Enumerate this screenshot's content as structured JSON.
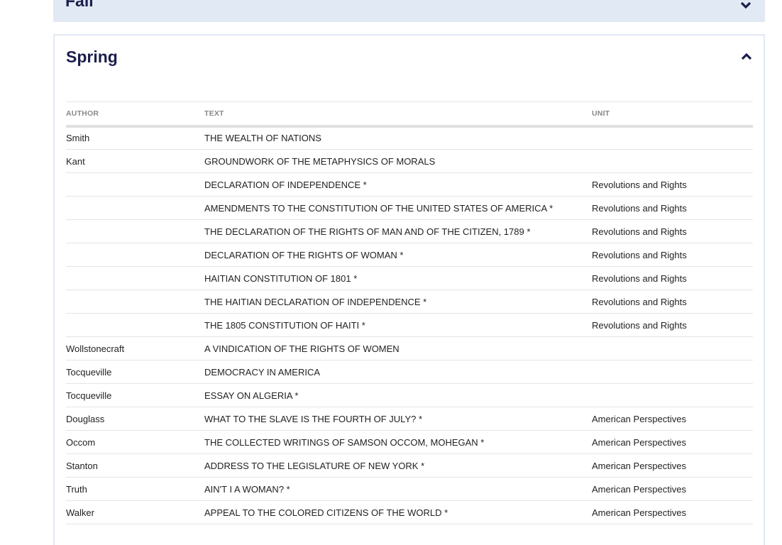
{
  "fall": {
    "title": "Fall"
  },
  "spring": {
    "title": "Spring",
    "headers": [
      "AUTHOR",
      "TEXT",
      "UNIT"
    ],
    "rows": [
      [
        "Smith",
        "THE WEALTH OF NATIONS",
        ""
      ],
      [
        "Kant",
        "GROUNDWORK OF THE METAPHYSICS OF MORALS",
        ""
      ],
      [
        "",
        "DECLARATION OF INDEPENDENCE *",
        "Revolutions and Rights"
      ],
      [
        "",
        "AMENDMENTS TO THE CONSTITUTION OF THE UNITED STATES OF AMERICA *",
        "Revolutions and Rights"
      ],
      [
        "",
        "THE DECLARATION OF THE RIGHTS OF MAN AND OF THE CITIZEN, 1789 *",
        "Revolutions and Rights"
      ],
      [
        "",
        "DECLARATION OF THE RIGHTS OF WOMAN *",
        "Revolutions and Rights"
      ],
      [
        "",
        "HAITIAN CONSTITUTION OF 1801 *",
        "Revolutions and Rights"
      ],
      [
        "",
        "THE HAITIAN DECLARATION OF INDEPENDENCE *",
        "Revolutions and Rights"
      ],
      [
        "",
        "THE 1805 CONSTITUTION OF HAITI *",
        "Revolutions and Rights"
      ],
      [
        "Wollstonecraft",
        "A VINDICATION OF THE RIGHTS OF WOMEN",
        ""
      ],
      [
        "Tocqueville",
        "DEMOCRACY IN AMERICA",
        ""
      ],
      [
        "Tocqueville",
        "ESSAY ON ALGERIA *",
        ""
      ],
      [
        "Douglass",
        "WHAT TO THE SLAVE IS THE FOURTH OF JULY? *",
        "American Perspectives"
      ],
      [
        "Occom",
        "THE COLLECTED WRITINGS OF SAMSON OCCOM, MOHEGAN *",
        "American Perspectives"
      ],
      [
        "Stanton",
        "ADDRESS TO THE LEGISLATURE OF NEW YORK *",
        "American Perspectives"
      ],
      [
        "Truth",
        "AIN'T I A WOMAN? *",
        "American Perspectives"
      ],
      [
        "Walker",
        "APPEAL TO THE COLORED CITIZENS OF THE WORLD *",
        "American Perspectives"
      ]
    ]
  }
}
